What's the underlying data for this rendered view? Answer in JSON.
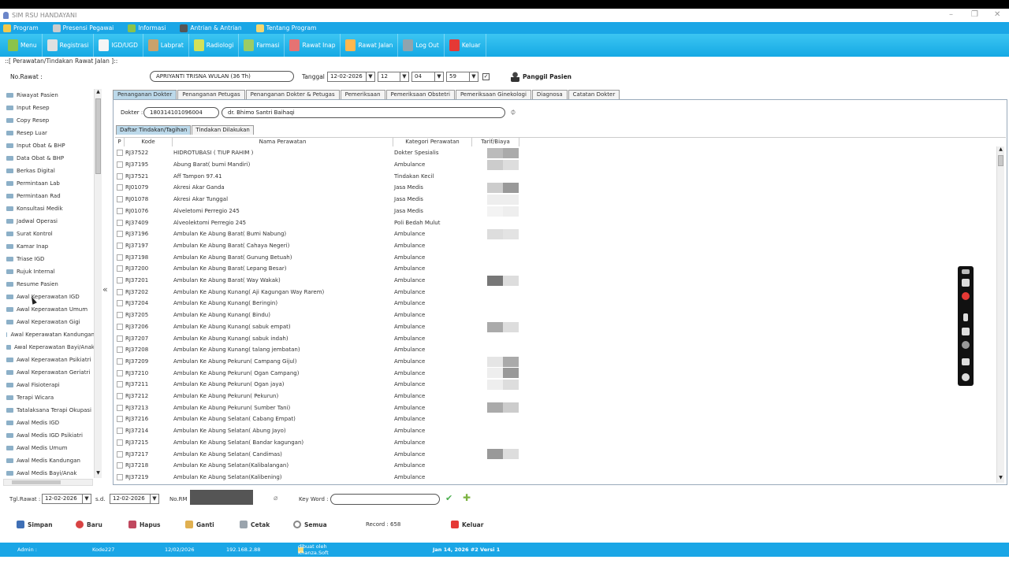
{
  "window": {
    "title": "SIM RSU HANDAYANI"
  },
  "menubar": [
    {
      "label": "Program",
      "icon": "program-icon",
      "color": "#f2c94c"
    },
    {
      "label": "Presensi Pegawai",
      "icon": "presensi-icon",
      "color": "#cccccc"
    },
    {
      "label": "Informasi",
      "icon": "informasi-icon",
      "color": "#8bc34a"
    },
    {
      "label": "Antrian & Antrian",
      "icon": "antrian-icon",
      "color": "#555555"
    },
    {
      "label": "Tentang Program",
      "icon": "tentang-icon",
      "color": "#f5d76e"
    }
  ],
  "toolbar": [
    {
      "label": "Menu",
      "icon": "menu-icon",
      "color": "#8bc34a"
    },
    {
      "label": "Registrasi",
      "icon": "registrasi-icon",
      "color": "#e0e0e0"
    },
    {
      "label": "IGD/UGD",
      "icon": "igd-icon",
      "color": "#f5f5f5"
    },
    {
      "label": "Labprat",
      "icon": "lab-icon",
      "color": "#c9a26b"
    },
    {
      "label": "Radiologi",
      "icon": "radiologi-icon",
      "color": "#d4e157"
    },
    {
      "label": "Farmasi",
      "icon": "farmasi-icon",
      "color": "#9ccc65"
    },
    {
      "label": "Rawat Inap",
      "icon": "rawat-inap-icon",
      "color": "#e57373"
    },
    {
      "label": "Rawat Jalan",
      "icon": "rawat-jalan-icon",
      "color": "#ffb74d"
    },
    {
      "label": "Log Out",
      "icon": "logout-icon",
      "color": "#90a4ae"
    },
    {
      "label": "Keluar",
      "icon": "keluar-icon",
      "color": "#e53935"
    }
  ],
  "breadcrumb": "::[ Perawatan/Tindakan Rawat Jalan ]::",
  "header": {
    "norawat_label": "No.Rawat :",
    "patient": "APRIYANTI TRISNA WULAN (36 Th)",
    "tanggal_label": "Tanggal :",
    "tanggal": "12-02-2026",
    "jam": "12",
    "menit": "04",
    "detik": "59",
    "panggil": "Panggil Pasien"
  },
  "sidebar": [
    "Riwayat Pasien",
    "Input Resep",
    "Copy Resep",
    "Resep Luar",
    "Input Obat & BHP",
    "Data Obat & BHP",
    "Berkas Digital",
    "Permintaan Lab",
    "Permintaan Rad",
    "Konsultasi Medik",
    "Jadwal Operasi",
    "Surat Kontrol",
    "Kamar Inap",
    "Triase IGD",
    "Rujuk Internal",
    "Resume Pasien",
    "Awal Keperawatan IGD",
    "Awal Keperawatan Umum",
    "Awal Keperawatan Gigi",
    "Awal Keperawatan Kandungan",
    "Awal Keperawatan Bayi/Anak",
    "Awal Keperawatan Psikiatri",
    "Awal Keperawatan Geriatri",
    "Awal Fisioterapi",
    "Terapi Wicara",
    "Tatalaksana Terapi Okupasi",
    "Awal Medis IGD",
    "Awal Medis IGD Psikiatri",
    "Awal Medis Umum",
    "Awal Medis Kandungan",
    "Awal Medis Bayi/Anak"
  ],
  "tabs": [
    "Penanganan Dokter",
    "Penanganan Petugas",
    "Penanganan Dokter & Petugas",
    "Pemeriksaan",
    "Pemeriksaan Obstetri",
    "Pemeriksaan Ginekologi",
    "Diagnosa",
    "Catatan Dokter"
  ],
  "dokter": {
    "label": "Dokter :",
    "kode": "180314101096004",
    "nama": "dr. Bhimo Santri Baihaqi"
  },
  "subtabs": [
    "Daftar Tindakan/Tagihan",
    "Tindakan Dilakukan"
  ],
  "grid": {
    "headers": [
      "P",
      "Kode",
      "Nama Perawatan",
      "Kategori Perawatan",
      "Tarif/Biaya"
    ],
    "rows": [
      {
        "kode": "RJ37522",
        "nama": " HIDROTUBASI ( TIUP RAHIM )",
        "kat": "Dokter Spesialis"
      },
      {
        "kode": "RJ37195",
        "nama": "Abung Barat( bumi Mandiri)",
        "kat": "Ambulance"
      },
      {
        "kode": "RJ37521",
        "nama": "Aff Tampon 97.41",
        "kat": "Tindakan Kecil"
      },
      {
        "kode": "RJ01079",
        "nama": "Akresi Akar Ganda",
        "kat": "Jasa Medis"
      },
      {
        "kode": "RJ01078",
        "nama": "Akresi Akar Tunggal",
        "kat": "Jasa Medis"
      },
      {
        "kode": "RJ01076",
        "nama": "Alveletomi Perregio 245",
        "kat": "Jasa Medis"
      },
      {
        "kode": "RJ37409",
        "nama": "Alveolektomi Perregio 245",
        "kat": "Poli Bedah Mulut"
      },
      {
        "kode": "RJ37196",
        "nama": "Ambulan Ke Abung Barat( Bumi Nabung)",
        "kat": "Ambulance"
      },
      {
        "kode": "RJ37197",
        "nama": "Ambulan Ke Abung Barat( Cahaya Negeri)",
        "kat": "Ambulance"
      },
      {
        "kode": "RJ37198",
        "nama": "Ambulan Ke Abung Barat( Gunung Betuah)",
        "kat": "Ambulance"
      },
      {
        "kode": "RJ37200",
        "nama": "Ambulan Ke Abung Barat( Lepang Besar)",
        "kat": "Ambulance"
      },
      {
        "kode": "RJ37201",
        "nama": "Ambulan Ke Abung Barat( Way Wakak)",
        "kat": "Ambulance"
      },
      {
        "kode": "RJ37202",
        "nama": "Ambulan Ke Abung Kunang( Aji Kagungan Way Rarem)",
        "kat": "Ambulance"
      },
      {
        "kode": "RJ37204",
        "nama": "Ambulan Ke Abung Kunang( Beringin)",
        "kat": "Ambulance"
      },
      {
        "kode": "RJ37205",
        "nama": "Ambulan Ke Abung Kunang( Bindu)",
        "kat": "Ambulance"
      },
      {
        "kode": "RJ37206",
        "nama": "Ambulan Ke Abung Kunang( sabuk empat)",
        "kat": "Ambulance"
      },
      {
        "kode": "RJ37207",
        "nama": "Ambulan Ke Abung Kunang( sabuk indah)",
        "kat": "Ambulance"
      },
      {
        "kode": "RJ37208",
        "nama": "Ambulan Ke Abung Kunang( talang jembatan)",
        "kat": "Ambulance"
      },
      {
        "kode": "RJ37209",
        "nama": "Ambulan Ke Abung Pekurun( Campang Gijul)",
        "kat": "Ambulance"
      },
      {
        "kode": "RJ37210",
        "nama": "Ambulan Ke Abung Pekurun( Ogan Campang)",
        "kat": "Ambulance"
      },
      {
        "kode": "RJ37211",
        "nama": "Ambulan Ke Abung Pekurun( Ogan jaya)",
        "kat": "Ambulance"
      },
      {
        "kode": "RJ37212",
        "nama": "Ambulan Ke Abung Pekurun( Pekurun)",
        "kat": "Ambulance"
      },
      {
        "kode": "RJ37213",
        "nama": "Ambulan Ke Abung Pekurun( Sumber Tani)",
        "kat": "Ambulance"
      },
      {
        "kode": "RJ37216",
        "nama": "Ambulan Ke Abung Selatan( Cabang Empat)",
        "kat": "Ambulance"
      },
      {
        "kode": "RJ37214",
        "nama": "Ambulan Ke Abung Selatan( Abung Jayo)",
        "kat": "Ambulance"
      },
      {
        "kode": "RJ37215",
        "nama": "Ambulan Ke Abung Selatan( Bandar kagungan)",
        "kat": "Ambulance"
      },
      {
        "kode": "RJ37217",
        "nama": "Ambulan Ke Abung Selatan( Candimas)",
        "kat": "Ambulance"
      },
      {
        "kode": "RJ37218",
        "nama": "Ambulan Ke Abung Selatan(Kalibalangan)",
        "kat": "Ambulance"
      },
      {
        "kode": "RJ37219",
        "nama": "Ambulan Ke Abung Selatan(Kalibening)",
        "kat": "Ambulance"
      }
    ]
  },
  "filter": {
    "tgl_label": "Tgl.Rawat :",
    "tgl_from": "12-02-2026",
    "sd_label": "s.d.",
    "tgl_to": "12-02-2026",
    "norm_label": "No.RM",
    "keyword_label": "Key Word :",
    "keyword": ""
  },
  "actions": {
    "simpan": "Simpan",
    "baru": "Baru",
    "hapus": "Hapus",
    "ganti": "Ganti",
    "cetak": "Cetak",
    "semua": "Semua",
    "record": "Record : 658",
    "keluar": "Keluar"
  },
  "status": {
    "user": "Admin :",
    "kode": "Kode227",
    "date": "12/02/2026",
    "ip": "192.168.2.88",
    "credit": "Didesain & dibuat oleh Khanza.Soft Media",
    "version": "Jan 14, 2026 #2 Versi 1"
  }
}
